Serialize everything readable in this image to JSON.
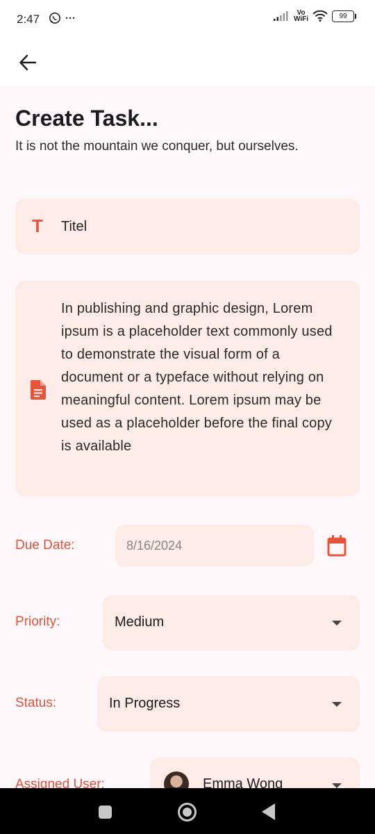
{
  "status_bar": {
    "time": "2:47",
    "whatsapp_icon": "whatsapp-icon",
    "more_dots": "···",
    "vo_top": "Vo",
    "vo_bottom": "WiFi",
    "battery": "99"
  },
  "app_bar": {
    "back_icon": "arrow-back-icon"
  },
  "page": {
    "title": "Create Task...",
    "subtitle": "It is not the mountain we conquer, but ourselves."
  },
  "form": {
    "title_icon_glyph": "T",
    "title_value": "Titel",
    "description_value": "In publishing and graphic design, Lorem ipsum is a placeholder text commonly used to demonstrate the visual form of a document or a typeface without relying on meaningful content. Lorem ipsum may be used as a placeholder before the final copy is available",
    "due_date_label": "Due Date:",
    "due_date_value": "8/16/2024",
    "priority_label": "Priority:",
    "priority_value": "Medium",
    "status_label": "Status:",
    "status_value": "In Progress",
    "assigned_label": "Assigned User:",
    "assigned_value": "Emma Wong"
  },
  "colors": {
    "accent": "#e5553b",
    "label": "#d9533c",
    "field_bg": "#fcebe7",
    "page_bg": "#fdf7fa"
  }
}
